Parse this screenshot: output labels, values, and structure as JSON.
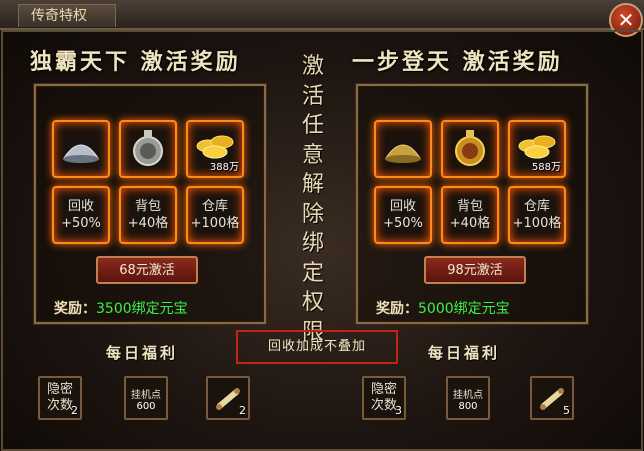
{
  "window": {
    "title": "传奇特权",
    "close": "✕"
  },
  "vertical_note": [
    "激",
    "活",
    "任",
    "意",
    "解",
    "除",
    "绑",
    "定",
    "权",
    "限"
  ],
  "notice": "回收加成不叠加",
  "left": {
    "heading": "独霸天下  激活奖励",
    "items": [
      {
        "icon": "hat-icon"
      },
      {
        "icon": "medal-icon"
      },
      {
        "icon": "gold-ingot-icon",
        "amount": "388万"
      }
    ],
    "perks": [
      {
        "line1": "回收",
        "line2": "+50%"
      },
      {
        "line1": "背包",
        "line2": "+40格"
      },
      {
        "line1": "仓库",
        "line2": "+100格"
      }
    ],
    "button": "68元激活",
    "reward_label": "奖励：",
    "reward_value": "3500绑定元宝",
    "daily": "每日福利",
    "daily_items": [
      {
        "line1": "隐密",
        "line2": "次数",
        "count": "2"
      },
      {
        "line1": "挂机点",
        "line2": "600"
      },
      {
        "icon": "scroll-icon",
        "count": "2"
      }
    ]
  },
  "right": {
    "heading": "一步登天  激活奖励",
    "items": [
      {
        "icon": "gold-hat-icon"
      },
      {
        "icon": "gold-medal-icon"
      },
      {
        "icon": "gold-ingot-icon",
        "amount": "588万"
      }
    ],
    "perks": [
      {
        "line1": "回收",
        "line2": "+50%"
      },
      {
        "line1": "背包",
        "line2": "+40格"
      },
      {
        "line1": "仓库",
        "line2": "+100格"
      }
    ],
    "button": "98元激活",
    "reward_label": "奖励：",
    "reward_value": "5000绑定元宝",
    "daily": "每日福利",
    "daily_items": [
      {
        "line1": "隐密",
        "line2": "次数",
        "count": "3"
      },
      {
        "line1": "挂机点",
        "line2": "800"
      },
      {
        "icon": "scroll-icon",
        "count": "5"
      }
    ]
  }
}
